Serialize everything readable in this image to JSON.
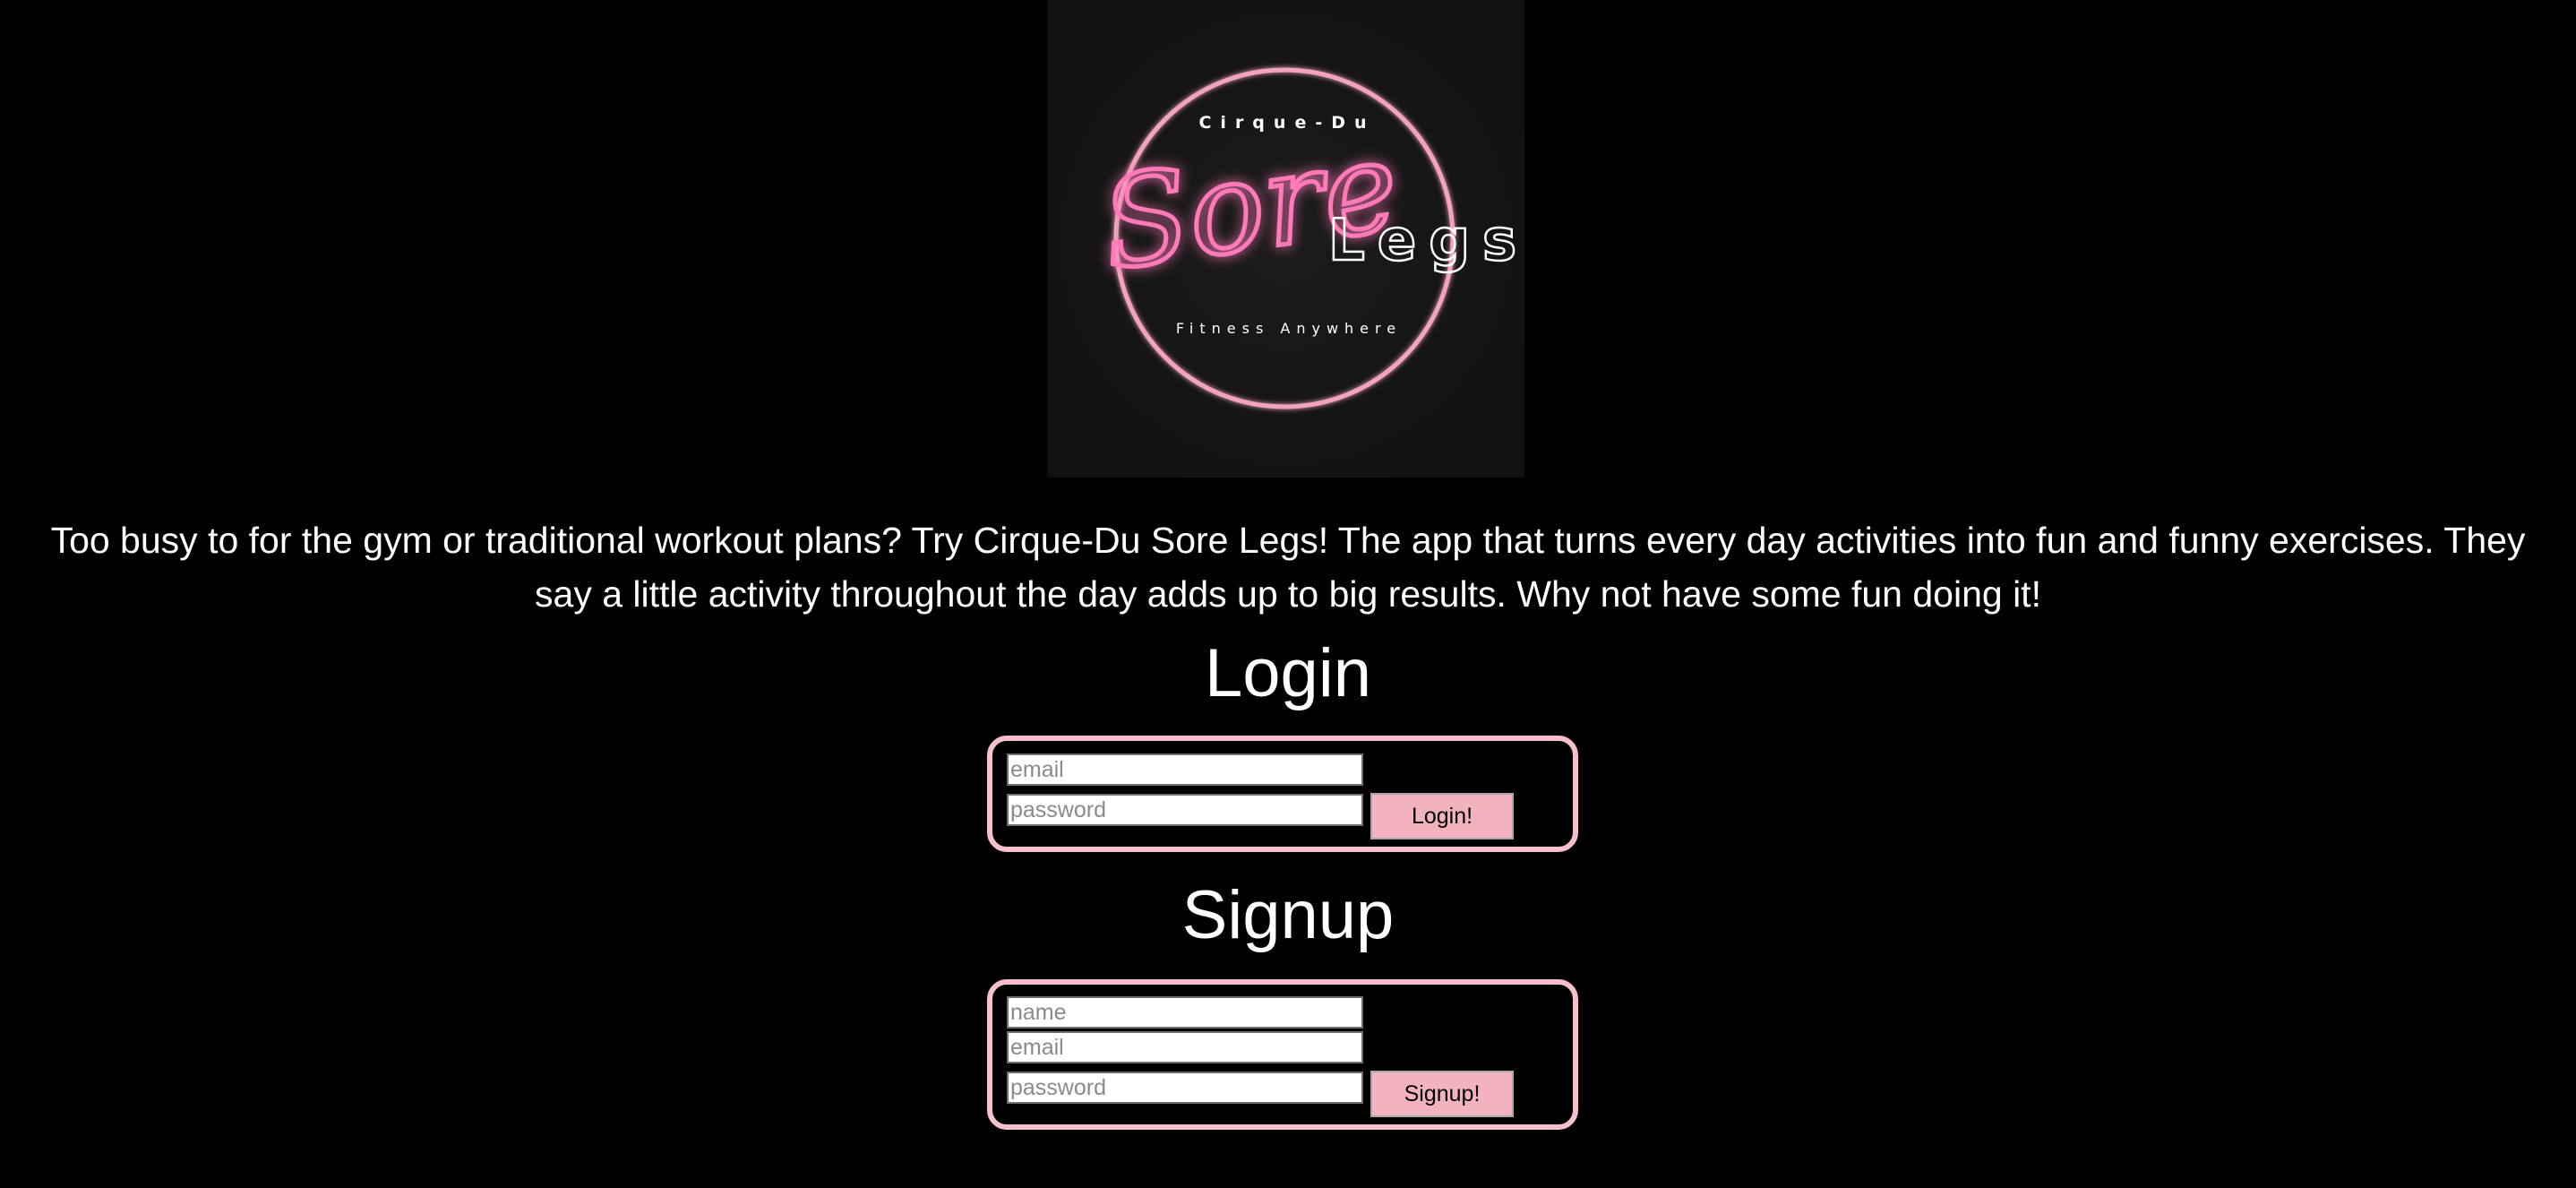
{
  "logo": {
    "top_text": "Cirque-Du",
    "script_text": "Sore",
    "main_text": "Legs",
    "sub_text": "Fitness Anywhere",
    "ring_color": "#f2a3bd",
    "neon_color": "#ff5fa8"
  },
  "tagline": "Too busy to for the gym or traditional workout plans? Try Cirque-Du Sore Legs! The app that turns every day activities into fun and funny exercises. They say a little activity throughout the day adds up to big results. Why not have some fun doing it!",
  "login": {
    "title": "Login",
    "email_placeholder": "email",
    "password_placeholder": "password",
    "button_label": "Login!"
  },
  "signup": {
    "title": "Signup",
    "name_placeholder": "name",
    "email_placeholder": "email",
    "password_placeholder": "password",
    "button_label": "Signup!"
  },
  "colors": {
    "background": "#000000",
    "accent_border": "#f6c1cb",
    "button_fill": "#f3b2bf"
  }
}
